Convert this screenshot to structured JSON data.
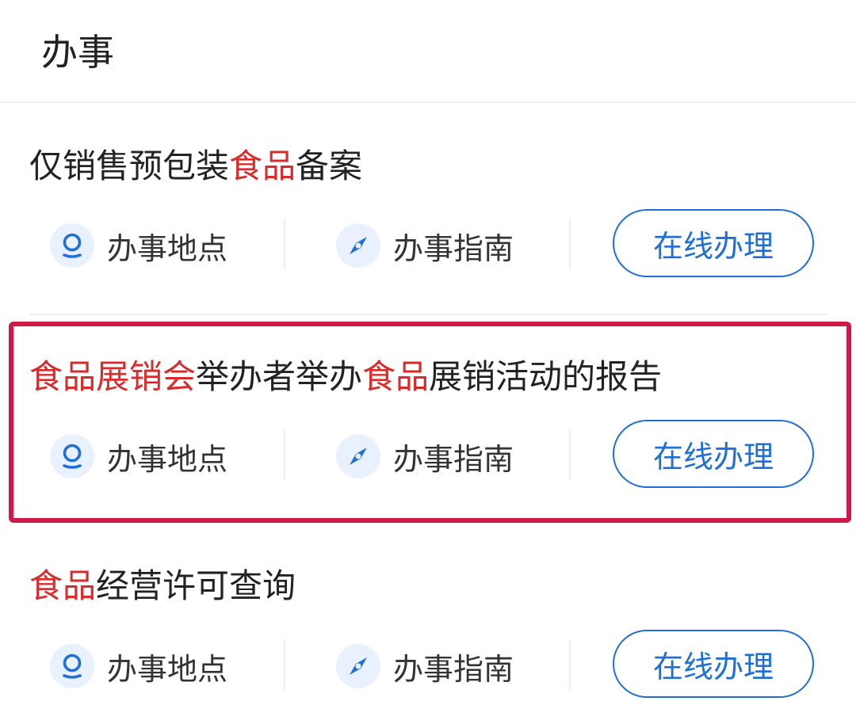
{
  "header": {
    "title": "办事"
  },
  "services": [
    {
      "title_segments": [
        {
          "text": "仅销售预包装",
          "highlight": false
        },
        {
          "text": "食品",
          "highlight": true
        },
        {
          "text": "备案",
          "highlight": false
        }
      ],
      "location_label": "办事地点",
      "guide_label": "办事指南",
      "online_label": "在线办理"
    },
    {
      "title_segments": [
        {
          "text": "食品展销会",
          "highlight": true
        },
        {
          "text": "举办者举办",
          "highlight": false
        },
        {
          "text": "食品",
          "highlight": true
        },
        {
          "text": "展销活动的报告",
          "highlight": false
        }
      ],
      "location_label": "办事地点",
      "guide_label": "办事指南",
      "online_label": "在线办理",
      "selected": true
    },
    {
      "title_segments": [
        {
          "text": "食品",
          "highlight": true
        },
        {
          "text": "经营许可查询",
          "highlight": false
        }
      ],
      "location_label": "办事地点",
      "guide_label": "办事指南",
      "online_label": "在线办理"
    }
  ],
  "colors": {
    "highlight_text": "#d92b2b",
    "primary_blue": "#1f6fd6",
    "selection_border": "#d01947",
    "icon_bg": "#e8f1fd"
  },
  "icons": {
    "location": "location-pin-icon",
    "guide": "compass-icon"
  }
}
